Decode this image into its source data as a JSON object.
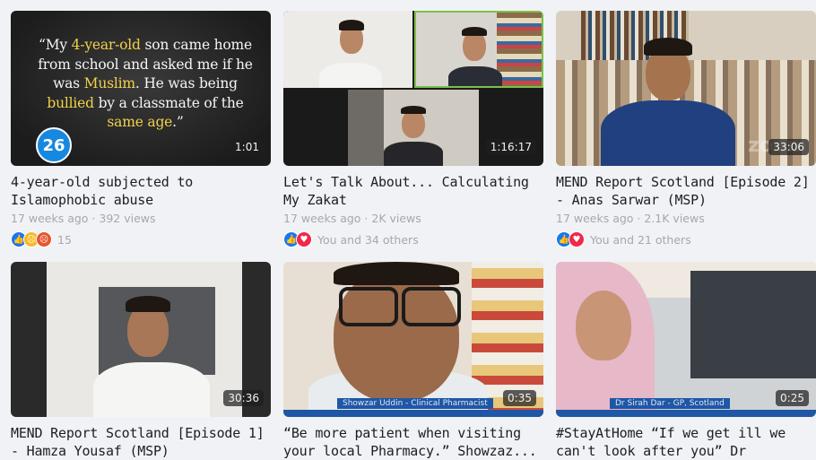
{
  "videos": [
    {
      "title": "4-year-old subjected to Islamophobic abuse",
      "meta": "17 weeks ago · 392 views",
      "duration": "1:01",
      "reactions": [
        "like",
        "sad",
        "angry"
      ],
      "reaction_count": "15",
      "badge": "26",
      "quote": {
        "p1": "“My ",
        "h1": "4-year-old",
        "p2": " son came home from school and asked me if he was ",
        "h2": "Muslim",
        "p3": ". He was being ",
        "h3": "bullied",
        "p4": " by a classmate of the ",
        "h4": "same age",
        "p5": ".”"
      }
    },
    {
      "title": "Let's Talk About... Calculating My Zakat",
      "meta": "17 weeks ago · 2K views",
      "duration": "1:16:17",
      "reactions": [
        "like",
        "love"
      ],
      "reaction_count": "You and 34 others"
    },
    {
      "title": "MEND Report Scotland [Episode 2] - Anas Sarwar (MSP)",
      "meta": "17 weeks ago · 2.1K views",
      "duration": "33:06",
      "reactions": [
        "like",
        "love"
      ],
      "reaction_count": "You and 21 others"
    },
    {
      "title": "MEND Report Scotland [Episode 1] - Hamza Yousaf (MSP)",
      "duration": "30:36"
    },
    {
      "title": "“Be more patient when visiting your local Pharmacy.” Showzaz...",
      "duration": "0:35",
      "lower_third": "Showzar Uddin - Clinical Pharmacist"
    },
    {
      "title": "#StayAtHome “If we get ill we can't look after you” Dr Sirah...",
      "duration": "0:25",
      "lower_third": "Dr Sirah Dar - GP, Scotland"
    }
  ],
  "colors": {
    "like": "#1877f2",
    "love": "#f0284a",
    "badge": "#1788e0",
    "highlight": "#f2d14a"
  }
}
